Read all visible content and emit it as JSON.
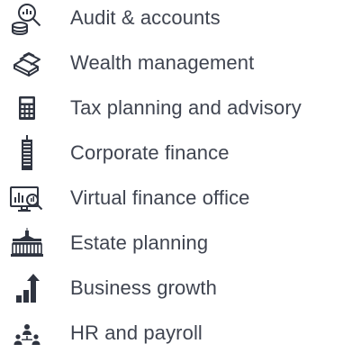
{
  "services": {
    "items": [
      {
        "label": "Audit & accounts",
        "icon": "magnifier-coins-icon"
      },
      {
        "label": "Wealth management",
        "icon": "gold-bars-icon"
      },
      {
        "label": "Tax planning and advisory",
        "icon": "calculator-icon"
      },
      {
        "label": "Corporate finance",
        "icon": "skyscraper-icon"
      },
      {
        "label": "Virtual finance office",
        "icon": "monitor-chart-icon"
      },
      {
        "label": "Estate planning",
        "icon": "mansion-icon"
      },
      {
        "label": "Business growth",
        "icon": "growth-bars-icon"
      },
      {
        "label": "HR and payroll",
        "icon": "people-group-icon"
      }
    ]
  },
  "colors": {
    "icon": "#2f3440",
    "text": "#3f4450",
    "background": "#ffffff"
  }
}
